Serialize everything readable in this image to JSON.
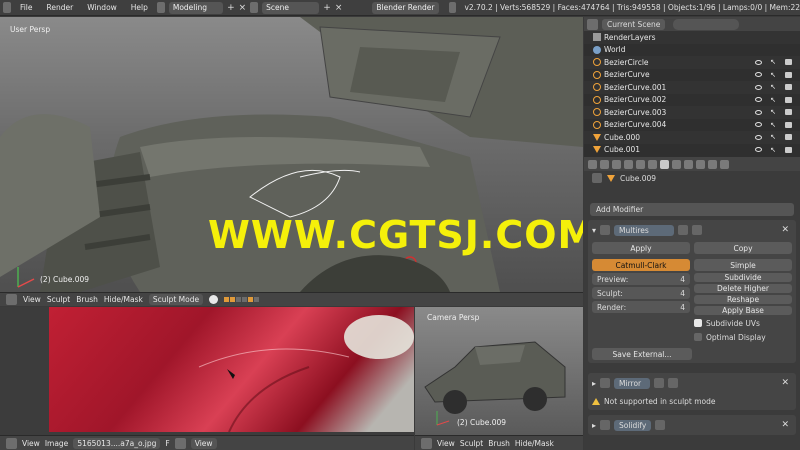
{
  "topbar": {
    "menus": [
      "File",
      "Render",
      "Window",
      "Help"
    ],
    "screen_layout": "Modeling",
    "scene": "Scene",
    "engine": "Blender Render",
    "info": "v2.70.2 | Verts:568529 | Faces:474764 | Tris:949558 | Objects:1/96 | Lamps:0/0 | Mem:22"
  },
  "viewport": {
    "view_label": "User Persp",
    "object_label": "(2) Cube.009",
    "watermark": "WWW.CGTSJ.COM",
    "header": {
      "menus": [
        "View",
        "Sculpt",
        "Brush",
        "Hide/Mask"
      ],
      "mode": "Sculpt Mode"
    }
  },
  "image_editor": {
    "header": {
      "menus": [
        "View",
        "Image"
      ],
      "image_name": "5165013....a7a_o.jpg",
      "fake_user": "F",
      "view_menu": "View"
    }
  },
  "camera_view": {
    "view_label": "Camera Persp",
    "object_label": "(2) Cube.009",
    "header": {
      "menus": [
        "View",
        "Sculpt",
        "Brush",
        "Hide/Mask"
      ]
    }
  },
  "outliner": {
    "display_mode": "Current Scene",
    "rows": [
      {
        "name": "RenderLayers",
        "icon": "layer"
      },
      {
        "name": "World",
        "icon": "world"
      },
      {
        "name": "BezierCircle",
        "icon": "curve"
      },
      {
        "name": "BezierCurve",
        "icon": "curve"
      },
      {
        "name": "BezierCurve.001",
        "icon": "curve"
      },
      {
        "name": "BezierCurve.002",
        "icon": "curve"
      },
      {
        "name": "BezierCurve.003",
        "icon": "curve"
      },
      {
        "name": "BezierCurve.004",
        "icon": "curve"
      },
      {
        "name": "Cube.000",
        "icon": "mesh"
      },
      {
        "name": "Cube.001",
        "icon": "mesh"
      }
    ]
  },
  "properties": {
    "context_object": "Cube.009",
    "add_modifier": "Add Modifier",
    "multires": {
      "name": "Multires",
      "apply": "Apply",
      "copy": "Copy",
      "catmull": "Catmull-Clark",
      "simple": "Simple",
      "preview_label": "Preview:",
      "preview_value": "4",
      "sculpt_label": "Sculpt:",
      "sculpt_value": "4",
      "render_label": "Render:",
      "render_value": "4",
      "subdivide": "Subdivide",
      "delete_higher": "Delete Higher",
      "reshape": "Reshape",
      "apply_base": "Apply Base",
      "subdivide_uvs": "Subdivide UVs",
      "optimal_display": "Optimal Display",
      "save_external": "Save External..."
    },
    "mirror": {
      "name": "Mirror",
      "warning": "Not supported in sculpt mode"
    },
    "solidify": {
      "name": "Solidify"
    }
  },
  "colors": {
    "accent": "#d68a34",
    "watermark": "#f5f00a",
    "panel": "#3b3b3b"
  }
}
